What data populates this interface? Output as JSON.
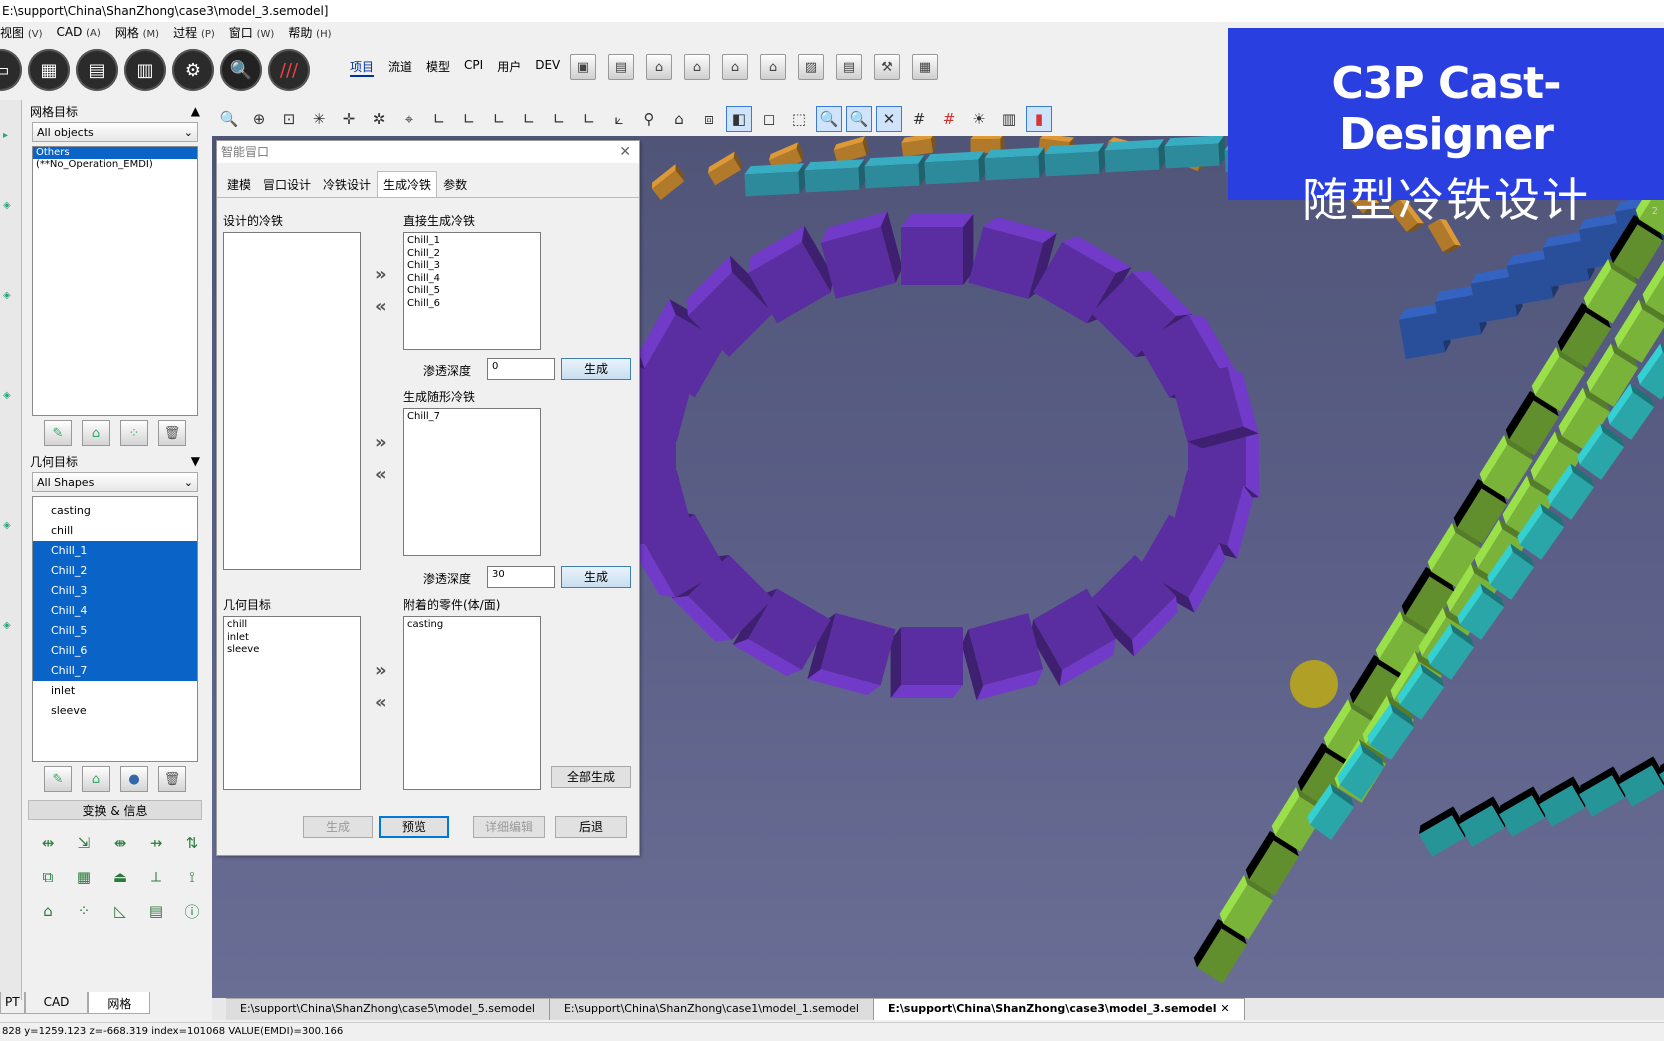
{
  "window": {
    "title": "E:\\support\\China\\ShanZhong\\case3\\model_3.semodel]"
  },
  "menu": [
    {
      "label": "视图",
      "key": "(V)"
    },
    {
      "label": "CAD",
      "key": "(A)"
    },
    {
      "label": "网格",
      "key": "(M)"
    },
    {
      "label": "过程",
      "key": "(P)"
    },
    {
      "label": "窗口",
      "key": "(W)"
    },
    {
      "label": "帮助",
      "key": "(H)"
    }
  ],
  "mode_tabs": [
    "项目",
    "流道",
    "模型",
    "CPI",
    "用户",
    "DEV"
  ],
  "left_panel": {
    "mesh_target_title": "网格目标",
    "mesh_filter": "All objects",
    "mesh_items": [
      "Others",
      "(**No_Operation_EMDI)"
    ],
    "geom_target_title": "几何目标",
    "geom_filter": "All Shapes",
    "geom_items": [
      "casting",
      "chill",
      "Chill_1",
      "Chill_2",
      "Chill_3",
      "Chill_4",
      "Chill_5",
      "Chill_6",
      "Chill_7",
      "inlet",
      "sleeve"
    ],
    "transform_title": "变换 & 信息"
  },
  "bottom_tabs": [
    "PT",
    "CAD",
    "网格"
  ],
  "dialog": {
    "title": "智能冒口",
    "tabs": [
      "建模",
      "冒口设计",
      "冷铁设计",
      "生成冷铁",
      "参数"
    ],
    "designed_chills_label": "设计的冷铁",
    "direct_label": "直接生成冷铁",
    "direct_items": [
      "Chill_1",
      "Chill_2",
      "Chill_3",
      "Chill_4",
      "Chill_5",
      "Chill_6"
    ],
    "depth_label": "渗透深度",
    "depth_value_1": "0",
    "generate": "生成",
    "conformal_label": "生成随形冷铁",
    "conformal_items": [
      "Chill_7"
    ],
    "depth_value_2": "30",
    "geom_label": "几何目标",
    "geom_items": [
      "chill",
      "inlet",
      "sleeve"
    ],
    "attached_label": "附着的零件(体/面)",
    "attached_items": [
      "casting"
    ],
    "generate_all": "全部生成",
    "footer": {
      "generate": "生成",
      "preview": "预览",
      "detail_edit": "详细编辑",
      "back": "后退"
    }
  },
  "banner": {
    "line1": "C3P Cast-Designer",
    "line2": "随型冷铁设计"
  },
  "file_tabs": [
    "E:\\support\\China\\ShanZhong\\case5\\model_5.semodel",
    "E:\\support\\China\\ShanZhong\\case1\\model_1.semodel",
    "E:\\support\\China\\ShanZhong\\case3\\model_3.semodel"
  ],
  "status": "828 y=1259.123 z=-668.319 index=101068 VALUE(EMDI)=300.166",
  "viewport_corner": "2",
  "colors": {
    "accent": "#0a64c8",
    "banner": "#2a3fe0",
    "chill_purple": "#5a2ea0",
    "chill_green": "#7ab33a",
    "chill_teal": "#2aa6a8"
  }
}
